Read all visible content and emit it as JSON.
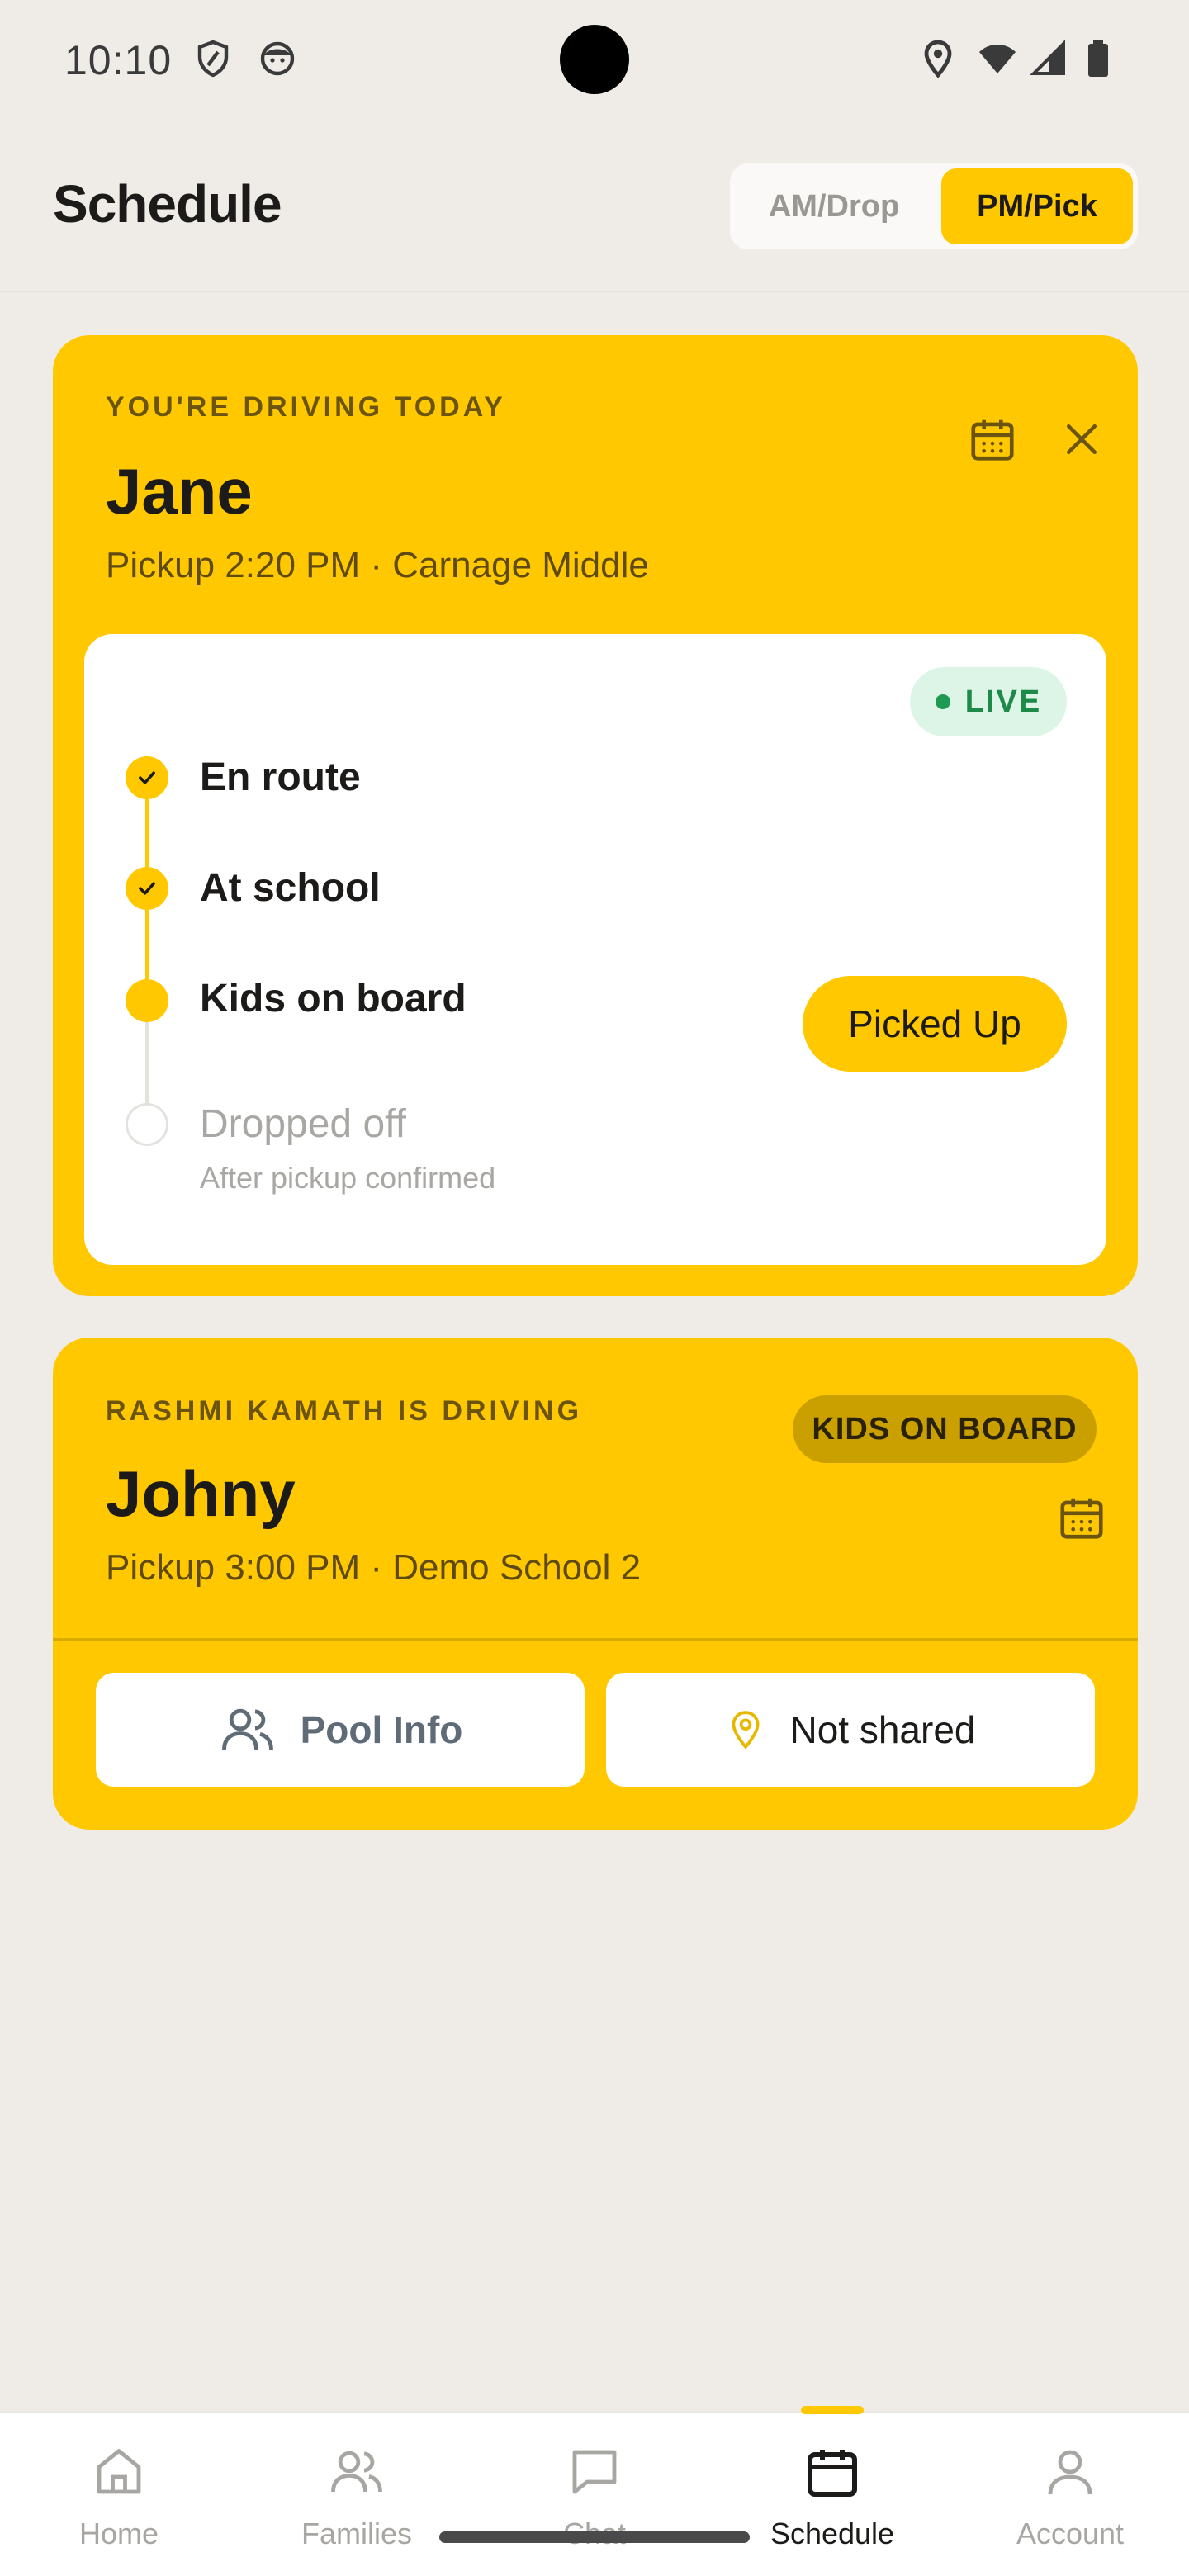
{
  "status_bar": {
    "time": "10:10",
    "icons": [
      "shield-icon",
      "face-icon",
      "location-icon",
      "wifi-icon",
      "signal-icon",
      "battery-icon"
    ]
  },
  "header": {
    "title": "Schedule",
    "segments": [
      {
        "label": "AM/Drop",
        "selected": false
      },
      {
        "label": "PM/Pick",
        "selected": true
      }
    ]
  },
  "active_trip": {
    "eyebrow": "YOU'RE DRIVING TODAY",
    "name": "Jane",
    "pickup": "Pickup 2:20 PM · Carnage Middle",
    "live_label": "LIVE",
    "steps": [
      {
        "label": "En route",
        "status": "done"
      },
      {
        "label": "At school",
        "status": "done"
      },
      {
        "label": "Kids on board",
        "status": "current"
      },
      {
        "label": "Dropped off",
        "status": "pending",
        "sub": "After pickup confirmed"
      }
    ],
    "action_label": "Picked Up"
  },
  "other_trip": {
    "eyebrow": "RASHMI KAMATH IS DRIVING",
    "status_badge": "KIDS ON BOARD",
    "name": "Johny",
    "pickup": "Pickup 3:00 PM · Demo School 2",
    "pool_info_label": "Pool Info",
    "share_label": "Not shared"
  },
  "bottom_nav": [
    {
      "label": "Home",
      "icon": "home-icon",
      "active": false
    },
    {
      "label": "Families",
      "icon": "families-icon",
      "active": false
    },
    {
      "label": "Chat",
      "icon": "chat-icon",
      "active": false
    },
    {
      "label": "Schedule",
      "icon": "calendar-icon",
      "active": true
    },
    {
      "label": "Account",
      "icon": "account-icon",
      "active": false
    }
  ],
  "colors": {
    "accent": "#FFC800",
    "background": "#EFECE8",
    "live_green": "#1E8A4A"
  }
}
